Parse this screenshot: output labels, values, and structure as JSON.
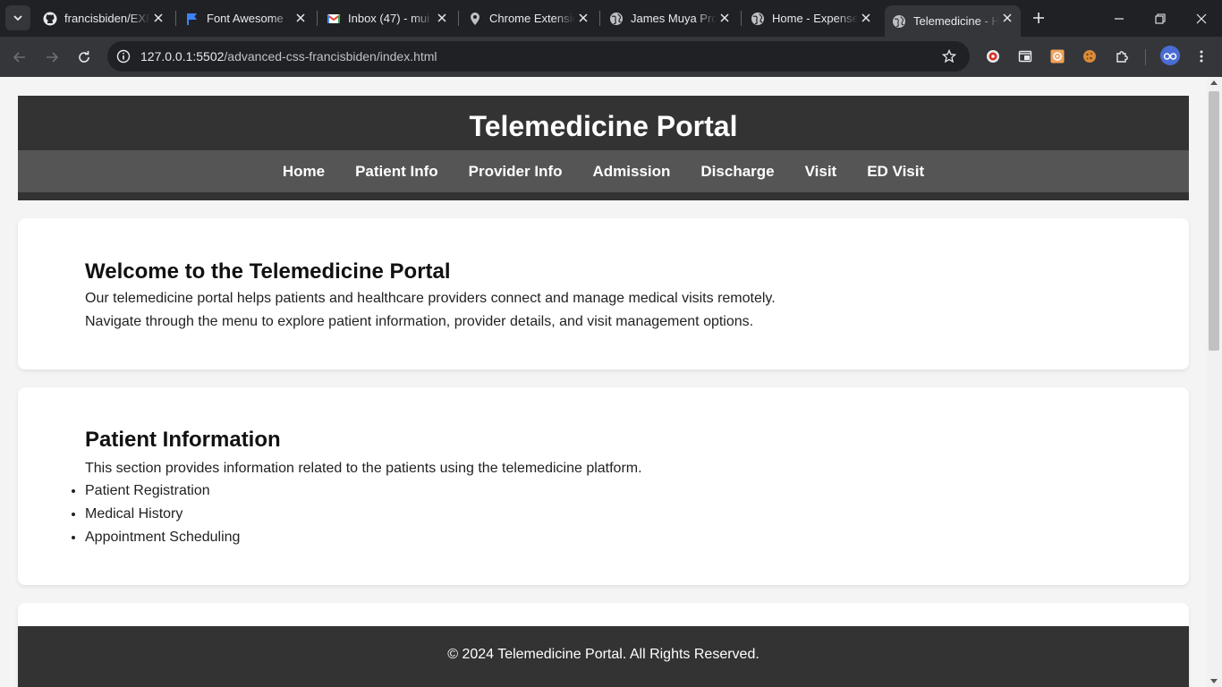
{
  "browser": {
    "tabs": [
      {
        "title": "francisbiden/EXP",
        "icon": "github-icon"
      },
      {
        "title": "Font Awesome",
        "icon": "flag-icon"
      },
      {
        "title": "Inbox (47) - mui",
        "icon": "gmail-icon"
      },
      {
        "title": "Chrome Extensio",
        "icon": "map-pin-icon"
      },
      {
        "title": "James Muya Pro",
        "icon": "globe-icon"
      },
      {
        "title": "Home - Expense",
        "icon": "globe-icon"
      },
      {
        "title": "Telemedicine - H",
        "icon": "globe-icon",
        "active": true
      }
    ],
    "url_host": "127.0.0.1:5502",
    "url_path": "/advanced-css-francisbiden/index.html"
  },
  "site": {
    "title": "Telemedicine Portal",
    "nav": [
      "Home",
      "Patient Info",
      "Provider Info",
      "Admission",
      "Discharge",
      "Visit",
      "ED Visit"
    ],
    "welcome": {
      "heading": "Welcome to the Telemedicine Portal",
      "line1": "Our telemedicine portal helps patients and healthcare providers connect and manage medical visits remotely.",
      "line2": "Navigate through the menu to explore patient information, provider details, and visit management options."
    },
    "patient": {
      "heading": "Patient Information",
      "intro": "This section provides information related to the patients using the telemedicine platform.",
      "items": [
        "Patient Registration",
        "Medical History",
        "Appointment Scheduling"
      ]
    },
    "footer": "© 2024 Telemedicine Portal. All Rights Reserved."
  },
  "colors": {
    "header_bg": "#333333",
    "nav_bg": "#555555",
    "page_bg": "#f4f4f4"
  }
}
